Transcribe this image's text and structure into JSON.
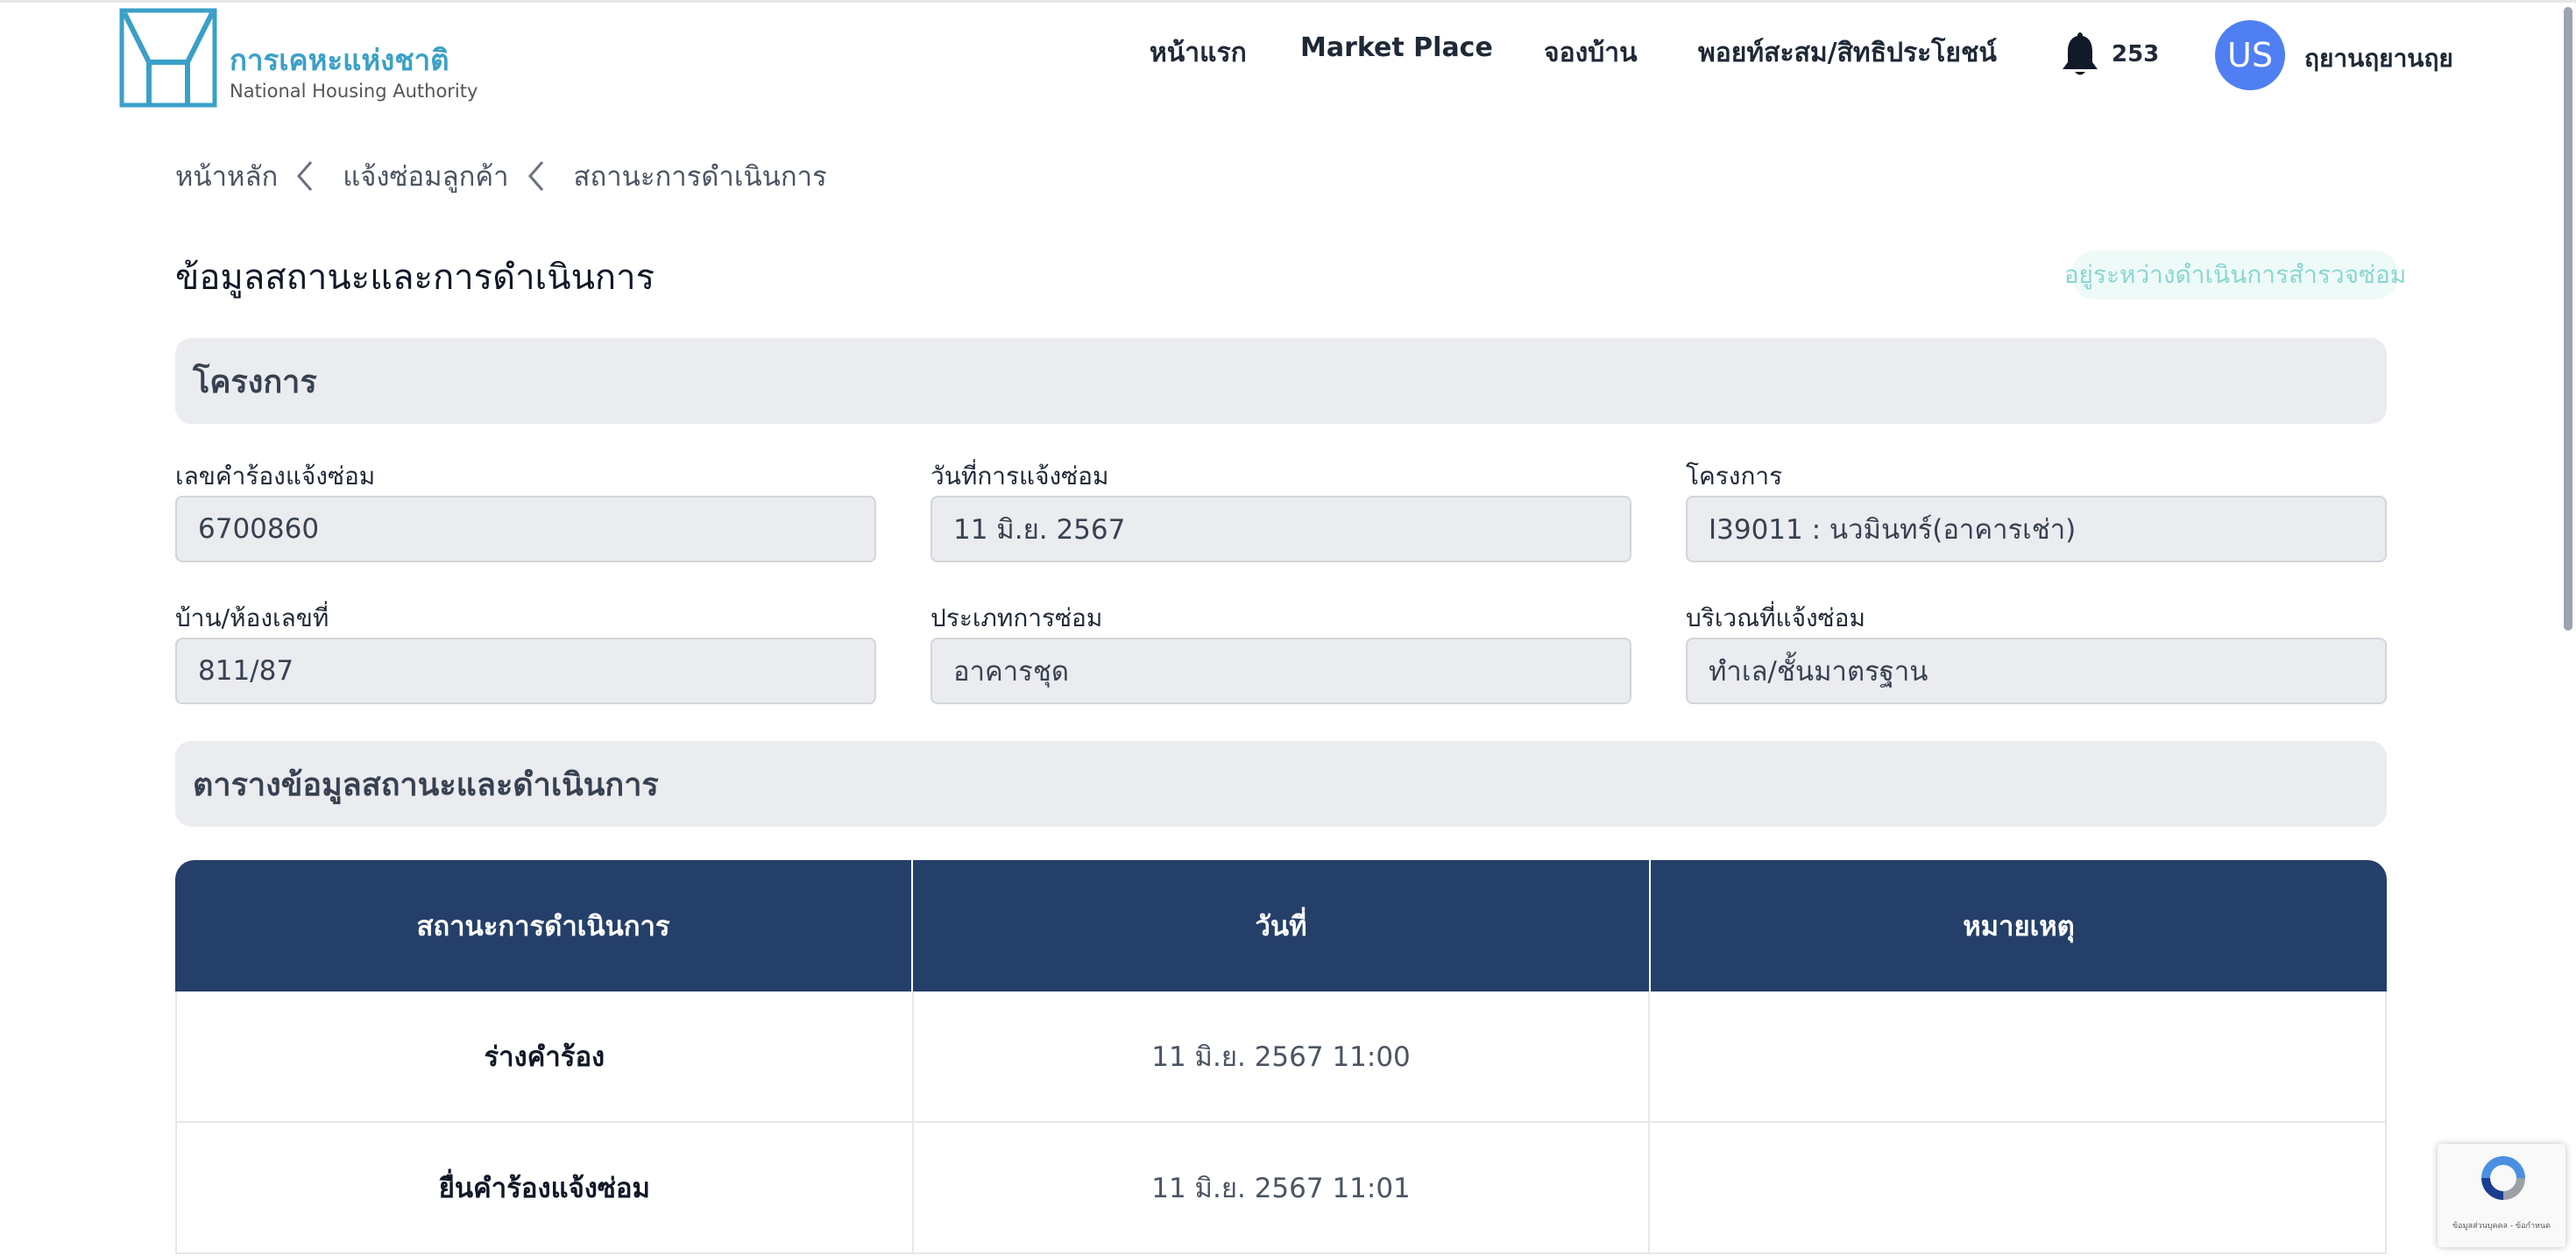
{
  "brand": {
    "name_th": "การเคหะแห่งชาติ",
    "name_en": "National Housing Authority",
    "color": "#3aa0c8"
  },
  "nav": {
    "items": [
      {
        "label": "หน้าแรก"
      },
      {
        "label": "Market Place"
      },
      {
        "label": "จองบ้าน"
      },
      {
        "label": "พอยท์สะสม/สิทธิประโยชน์"
      }
    ],
    "notification_icon": "bell-icon",
    "notification_count": "253",
    "avatar_initials": "US",
    "avatar_color": "#4f7ff2",
    "username": "ฤยานฤยานฤย"
  },
  "breadcrumb": {
    "items": [
      "หน้าหลัก",
      "แจ้งซ่อมลูกค้า",
      "สถานะการดำเนินการ"
    ]
  },
  "page": {
    "title": "ข้อมูลสถานะและการดำเนินการ",
    "status_badge": "อยู่ระหว่างดำเนินการสำรวจซ่อม"
  },
  "project_section": {
    "header": "โครงการ",
    "fields": [
      {
        "label": "เลขคำร้องแจ้งซ่อม",
        "value": "6700860"
      },
      {
        "label": "วันที่การแจ้งซ่อม",
        "value": "11 มิ.ย. 2567"
      },
      {
        "label": "โครงการ",
        "value": "I39011 : นวมินทร์(อาคารเช่า)"
      },
      {
        "label": "บ้าน/ห้องเลขที่",
        "value": "811/87"
      },
      {
        "label": "ประเภทการซ่อม",
        "value": "อาคารชุด"
      },
      {
        "label": "บริเวณที่แจ้งซ่อม",
        "value": "ทำเล/ชั้นมาตรฐาน"
      }
    ]
  },
  "status_table": {
    "header": "ตารางข้อมูลสถานะและดำเนินการ",
    "columns": [
      "สถานะการดำเนินการ",
      "วันที่",
      "หมายเหตุ"
    ],
    "header_color": "#243f69",
    "rows": [
      {
        "status": "ร่างคำร้อง",
        "date": "11 มิ.ย. 2567 11:00",
        "note": ""
      },
      {
        "status": "ยื่นคำร้องแจ้งซ่อม",
        "date": "11 มิ.ย. 2567 11:01",
        "note": ""
      }
    ]
  },
  "recaptcha": {
    "icon": "recaptcha-icon",
    "text": "ข้อมูลส่วนบุคคล - ข้อกำหนด"
  }
}
